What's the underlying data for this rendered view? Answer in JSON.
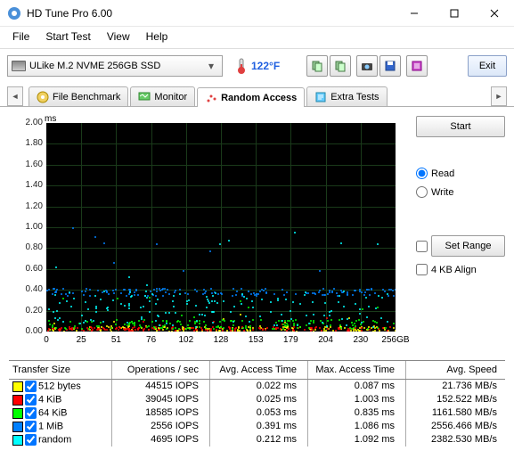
{
  "window": {
    "title": "HD Tune Pro 6.00"
  },
  "menu": {
    "file": "File",
    "start": "Start Test",
    "view": "View",
    "help": "Help"
  },
  "toolbar": {
    "drive": "ULike M.2 NVME 256GB SSD",
    "temperature": "122°F",
    "exit": "Exit"
  },
  "tabs": {
    "file_benchmark": "File Benchmark",
    "monitor": "Monitor",
    "random_access": "Random Access",
    "extra_tests": "Extra Tests"
  },
  "side": {
    "start": "Start",
    "read": "Read",
    "write": "Write",
    "set_range": "Set Range",
    "align": "4 KB Align"
  },
  "chart_data": {
    "type": "scatter",
    "title": "",
    "xlabel": "",
    "ylabel": "ms",
    "xlim": [
      0,
      256
    ],
    "ylim": [
      0,
      2.0
    ],
    "xunit": "GB",
    "xticks": [
      0,
      25,
      51,
      76,
      102,
      128,
      153,
      179,
      204,
      230,
      "256GB"
    ],
    "yticks": [
      2.0,
      1.8,
      1.6,
      1.4,
      1.2,
      1.0,
      0.8,
      0.6,
      0.4,
      0.2,
      0
    ],
    "series": [
      {
        "name": "512 bytes",
        "color": "#ffff00",
        "band_ms": [
          0.01,
          0.06
        ]
      },
      {
        "name": "4 KiB",
        "color": "#ff0000",
        "band_ms": [
          0.015,
          0.05
        ]
      },
      {
        "name": "64 KiB",
        "color": "#00ff00",
        "band_ms": [
          0.03,
          0.12
        ]
      },
      {
        "name": "1 MiB",
        "color": "#0080ff",
        "band_ms": [
          0.35,
          0.42
        ]
      },
      {
        "name": "random",
        "color": "#00ffff",
        "band_ms": [
          0.05,
          0.4
        ]
      }
    ]
  },
  "table": {
    "headers": {
      "size": "Transfer Size",
      "ops": "Operations / sec",
      "avg": "Avg. Access Time",
      "max": "Max. Access Time",
      "speed": "Avg. Speed"
    },
    "rows": [
      {
        "color": "#ffff00",
        "size": "512 bytes",
        "ops": "44515 IOPS",
        "avg": "0.022 ms",
        "max": "0.087 ms",
        "speed": "21.736 MB/s"
      },
      {
        "color": "#ff0000",
        "size": "4 KiB",
        "ops": "39045 IOPS",
        "avg": "0.025 ms",
        "max": "1.003 ms",
        "speed": "152.522 MB/s"
      },
      {
        "color": "#00ff00",
        "size": "64 KiB",
        "ops": "18585 IOPS",
        "avg": "0.053 ms",
        "max": "0.835 ms",
        "speed": "1161.580 MB/s"
      },
      {
        "color": "#0080ff",
        "size": "1 MiB",
        "ops": "2556 IOPS",
        "avg": "0.391 ms",
        "max": "1.086 ms",
        "speed": "2556.466 MB/s"
      },
      {
        "color": "#00ffff",
        "size": "random",
        "ops": "4695 IOPS",
        "avg": "0.212 ms",
        "max": "1.092 ms",
        "speed": "2382.530 MB/s"
      }
    ]
  }
}
